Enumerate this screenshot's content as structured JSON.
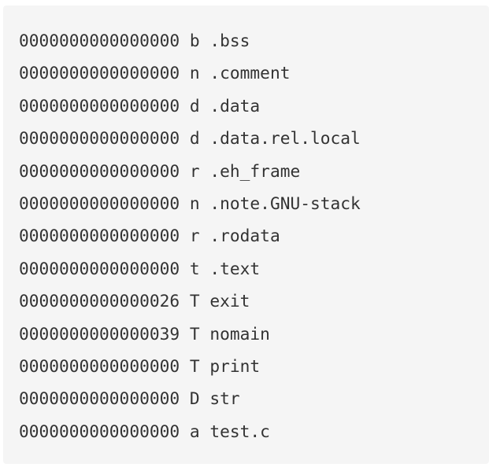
{
  "symbols": [
    {
      "address": "0000000000000000",
      "type": "b",
      "name": ".bss"
    },
    {
      "address": "0000000000000000",
      "type": "n",
      "name": ".comment"
    },
    {
      "address": "0000000000000000",
      "type": "d",
      "name": ".data"
    },
    {
      "address": "0000000000000000",
      "type": "d",
      "name": ".data.rel.local"
    },
    {
      "address": "0000000000000000",
      "type": "r",
      "name": ".eh_frame"
    },
    {
      "address": "0000000000000000",
      "type": "n",
      "name": ".note.GNU-stack"
    },
    {
      "address": "0000000000000000",
      "type": "r",
      "name": ".rodata"
    },
    {
      "address": "0000000000000000",
      "type": "t",
      "name": ".text"
    },
    {
      "address": "0000000000000026",
      "type": "T",
      "name": "exit"
    },
    {
      "address": "0000000000000039",
      "type": "T",
      "name": "nomain"
    },
    {
      "address": "0000000000000000",
      "type": "T",
      "name": "print"
    },
    {
      "address": "0000000000000000",
      "type": "D",
      "name": "str"
    },
    {
      "address": "0000000000000000",
      "type": "a",
      "name": "test.c"
    }
  ]
}
